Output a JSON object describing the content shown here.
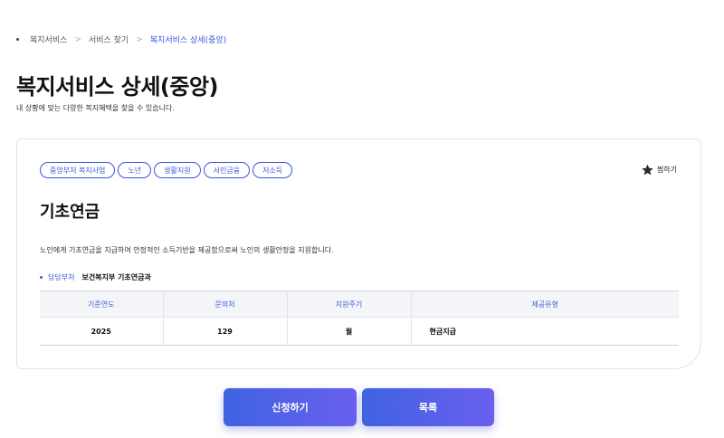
{
  "breadcrumb": {
    "items": [
      "복지서비스",
      "서비스 찾기",
      "복지서비스 상세(중앙)"
    ],
    "separator": ">"
  },
  "header": {
    "title": "복지서비스 상세(중앙)",
    "subtitle": "내 상황에 맞는 다양한 복지혜택을 찾을 수 있습니다."
  },
  "service": {
    "tags": [
      "중앙부처 복지사업",
      "노년",
      "생활지원",
      "서민금융",
      "저소득"
    ],
    "favorite_label": "찜하기",
    "name": "기초연금",
    "description": "노인에게 기초연금을 지급하여 안정적인 소득기반을 제공함으로써 노인의 생활안정을 지원합니다.",
    "department": {
      "label": "담당부처",
      "value": "보건복지부 기초연금과"
    },
    "table": {
      "headers": [
        "기준연도",
        "문의처",
        "지원주기",
        "제공유형"
      ],
      "rows": [
        [
          "2025",
          "129",
          "월",
          "현금지급"
        ]
      ]
    }
  },
  "actions": {
    "apply_label": "신청하기",
    "list_label": "목록"
  },
  "colors": {
    "accent": "#3b57d9",
    "button_gradient_start": "#3f63e0",
    "button_gradient_end": "#6a5ff0"
  },
  "icons": {
    "favorite": "star-icon"
  }
}
